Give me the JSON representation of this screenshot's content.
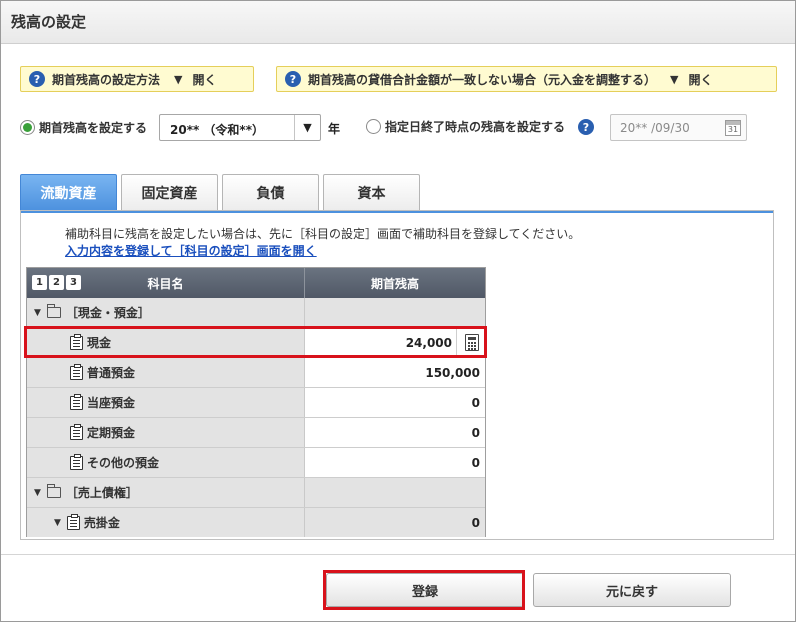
{
  "header": {
    "title": "残高の設定"
  },
  "help": {
    "method": {
      "label": "期首残高の設定方法",
      "toggle": "開く"
    },
    "mismatch": {
      "label": "期首残高の貸借合計金額が一致しない場合（元入金を調整する）",
      "toggle": "開く"
    }
  },
  "options": {
    "opening": {
      "label": "期首残高を設定する",
      "selected": true
    },
    "year_select": {
      "value": "20** （令和**）",
      "unit": "年"
    },
    "specific": {
      "label": "指定日終了時点の残高を設定する",
      "selected": false
    },
    "date": {
      "value": "20** /09/30",
      "cal_day": "31"
    }
  },
  "tabs": [
    {
      "label": "流動資産",
      "active": true
    },
    {
      "label": "固定資産",
      "active": false
    },
    {
      "label": "負債",
      "active": false
    },
    {
      "label": "資本",
      "active": false
    }
  ],
  "notice": {
    "text": "補助科目に残高を設定したい場合は、先に［科目の設定］画面で補助科目を登録してください。",
    "link": "入力内容を登録して［科目の設定］画面を開く"
  },
  "grid": {
    "levels": [
      "1",
      "2",
      "3"
    ],
    "columns": {
      "name": "科目名",
      "balance": "期首残高"
    },
    "rows": [
      {
        "type": "group",
        "name": "［現金・預金］",
        "value": ""
      },
      {
        "type": "item",
        "name": "現金",
        "value": "24,000",
        "editing": true
      },
      {
        "type": "item",
        "name": "普通預金",
        "value": "150,000"
      },
      {
        "type": "item",
        "name": "当座預金",
        "value": "0"
      },
      {
        "type": "item",
        "name": "定期預金",
        "value": "0"
      },
      {
        "type": "item",
        "name": "その他の預金",
        "value": "0"
      },
      {
        "type": "group",
        "name": "［売上債権］",
        "value": ""
      },
      {
        "type": "item-parent",
        "name": "売掛金",
        "value": "0"
      }
    ]
  },
  "buttons": {
    "register": "登録",
    "reset": "元に戻す"
  },
  "colors": {
    "highlight": "#d8121b",
    "tab_active": "#4c91de",
    "help_bg": "#fffbd1",
    "radio_on": "#3aa03a"
  },
  "icons": {
    "help": "question-circle-icon",
    "folder": "folder-icon",
    "account": "clipboard-icon",
    "calculator": "calculator-icon",
    "calendar": "calendar-icon"
  }
}
